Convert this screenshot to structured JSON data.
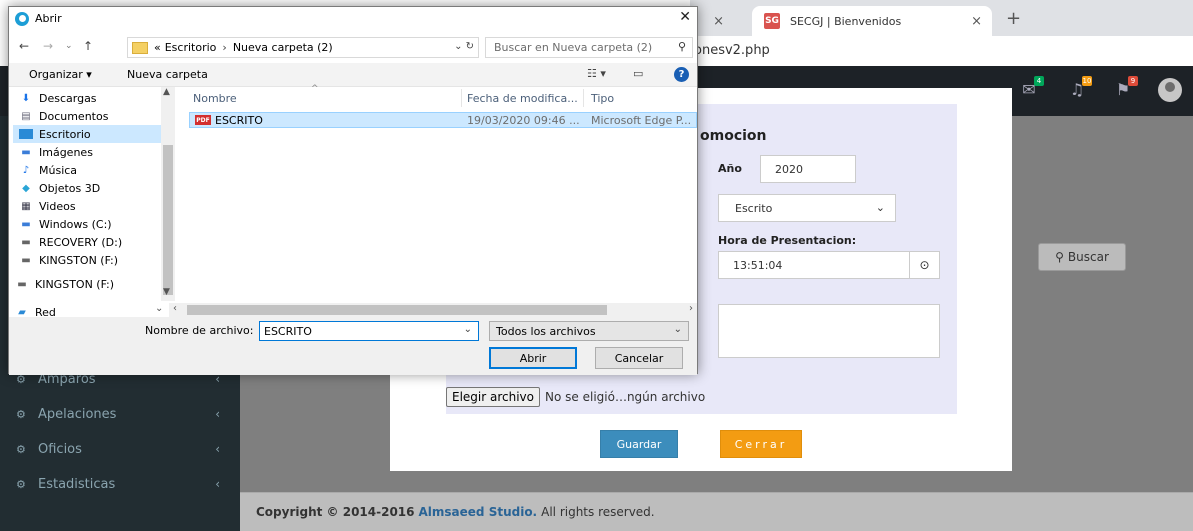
{
  "browser": {
    "tab1_close": "×",
    "tab2_favicon": "SG",
    "tab2_title": "SECGJ | Bienvenidos",
    "tab2_close": "×",
    "new_tab": "+",
    "url_visible": "onesv2.php"
  },
  "header": {
    "badges": [
      {
        "icon": "envelope-icon",
        "count": "4",
        "color": "#00a65a"
      },
      {
        "icon": "bell-icon",
        "count": "10",
        "color": "#f39c12"
      },
      {
        "icon": "flag-icon",
        "count": "9",
        "color": "#dd4b39"
      }
    ]
  },
  "sidebar": {
    "items": [
      {
        "label": "Amparos",
        "icon": "dashboard-icon"
      },
      {
        "label": "Apelaciones",
        "icon": "dashboard-icon"
      },
      {
        "label": "Oficios",
        "icon": "dashboard-icon"
      },
      {
        "label": "Estadisticas",
        "icon": "dashboard-icon"
      }
    ],
    "chevron": "‹"
  },
  "content": {
    "buscar_label": "Buscar"
  },
  "footer": {
    "copyright": "Copyright © 2014-2016",
    "company": "Almsaeed Studio.",
    "rights": "All rights reserved."
  },
  "modal": {
    "title_visible": "omocion",
    "anio_label": "Año",
    "anio_value": "2020",
    "tipo_value": "Escrito",
    "hora_label": "Hora de Presentacion:",
    "hora_value": "13:51:04",
    "file_button": "Elegir archivo",
    "file_status": "No se eligió…ngún archivo",
    "guardar": "Guardar",
    "cerrar": "Cerrar"
  },
  "dialog": {
    "title": "Abrir",
    "close": "✕",
    "breadcrumb": {
      "prefix": "«",
      "parts": [
        "Escritorio",
        "Nueva carpeta (2)"
      ]
    },
    "search_placeholder": "Buscar en Nueva carpeta (2)",
    "organizar": "Organizar ▾",
    "nueva_carpeta": "Nueva carpeta",
    "nav_items": [
      {
        "label": "Descargas",
        "icon": "download-icon"
      },
      {
        "label": "Documentos",
        "icon": "document-icon"
      },
      {
        "label": "Escritorio",
        "icon": "desktop-icon",
        "selected": true
      },
      {
        "label": "Imágenes",
        "icon": "image-icon"
      },
      {
        "label": "Música",
        "icon": "music-icon"
      },
      {
        "label": "Objetos 3D",
        "icon": "cube-icon"
      },
      {
        "label": "Videos",
        "icon": "video-icon"
      },
      {
        "label": "Windows (C:)",
        "icon": "drive-icon"
      },
      {
        "label": "RECOVERY (D:)",
        "icon": "drive-icon"
      },
      {
        "label": "KINGSTON (F:)",
        "icon": "drive-icon"
      },
      {
        "label": "KINGSTON (F:)",
        "icon": "drive-icon"
      },
      {
        "label": "Red",
        "icon": "network-icon"
      }
    ],
    "columns": [
      "Nombre",
      "Fecha de modifica...",
      "Tipo"
    ],
    "files": [
      {
        "name": "ESCRITO",
        "date": "19/03/2020 09:46 ...",
        "type": "Microsoft Edge P..."
      }
    ],
    "filename_label": "Nombre de archivo:",
    "filename_value": "ESCRITO",
    "filetype_value": "Todos los archivos",
    "open_button": "Abrir",
    "cancel_button": "Cancelar"
  }
}
